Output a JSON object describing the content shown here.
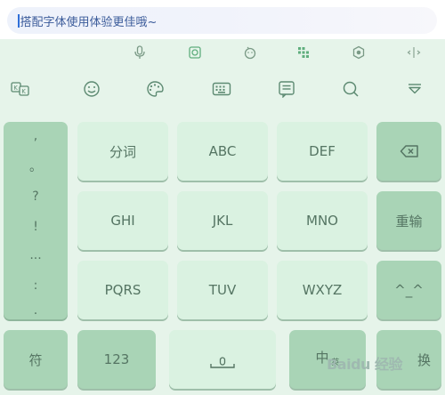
{
  "search": {
    "text": "搭配字体使用体验更佳哦~"
  },
  "toolbar_row1": [
    {
      "icon": "microphone-icon"
    },
    {
      "icon": "scan-icon"
    },
    {
      "icon": "emoji-face-icon"
    },
    {
      "icon": "keyboard-grid-icon"
    },
    {
      "icon": "settings-hex-icon"
    },
    {
      "icon": "cursor-move-icon"
    }
  ],
  "toolbar_row2": [
    {
      "icon": "keyboard-switch-icon"
    },
    {
      "icon": "smiley-icon"
    },
    {
      "icon": "palette-icon"
    },
    {
      "icon": "keyboard-icon",
      "badge": true
    },
    {
      "icon": "clipboard-icon"
    },
    {
      "icon": "search-icon",
      "badge": true
    },
    {
      "icon": "collapse-keyboard-icon"
    }
  ],
  "punctuation": [
    ",",
    "。",
    "?",
    "!",
    "...",
    ":",
    "."
  ],
  "keys": {
    "fenci": "分词",
    "abc": "ABC",
    "def": "DEF",
    "ghi": "GHI",
    "jkl": "JKL",
    "mno": "MNO",
    "chongshu": "重输",
    "pqrs": "PQRS",
    "tuv": "TUV",
    "wxyz": "WXYZ",
    "face": "^_^",
    "symbol": "符",
    "num": "123",
    "zh": "中",
    "zh_sub": "/英",
    "enter_visible": "换"
  },
  "watermark": "Baidu 经验",
  "colors": {
    "key_light": "#daf2e1",
    "key_dark": "#a9d4b6",
    "background": "#e6f4ea",
    "badge": "#ee3a34"
  }
}
